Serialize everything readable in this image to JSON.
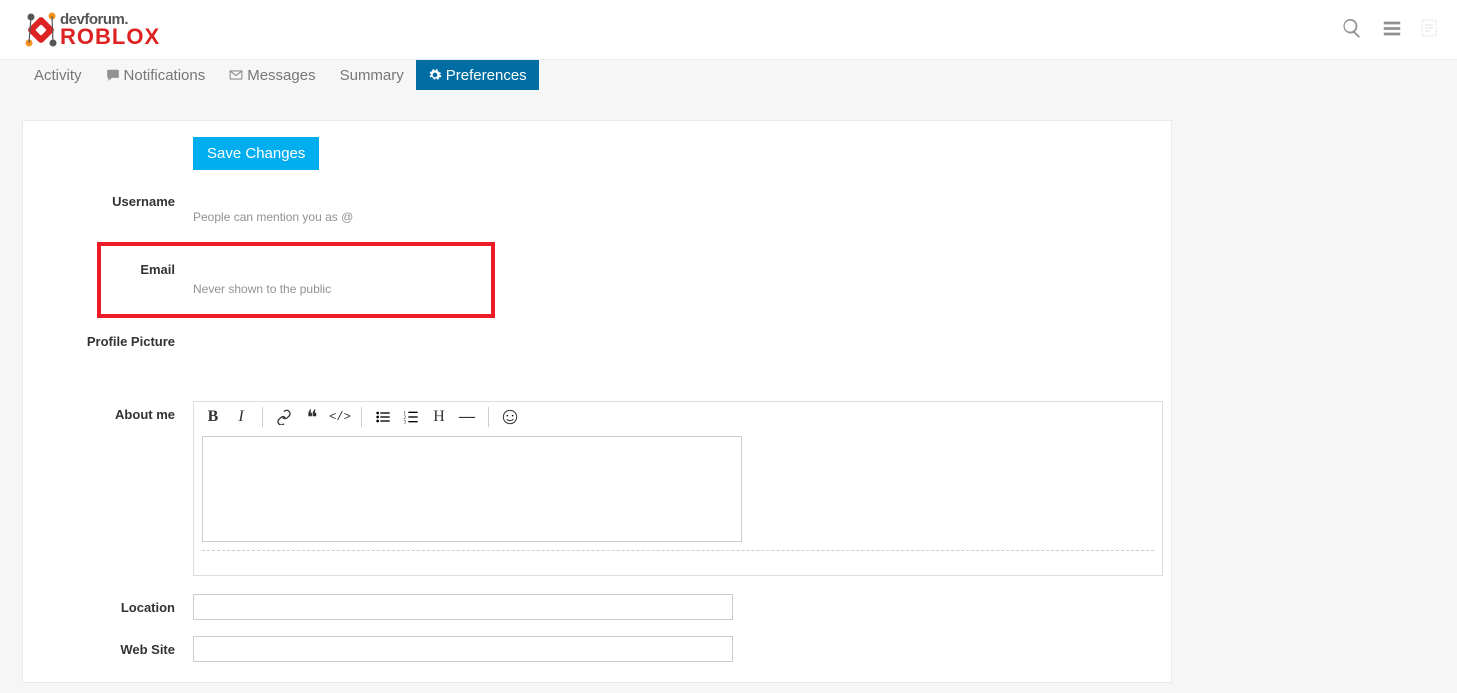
{
  "logo": {
    "top": "devforum",
    "bottom": "ROBLOX"
  },
  "tabs": {
    "activity": "Activity",
    "notifications": "Notifications",
    "messages": "Messages",
    "summary": "Summary",
    "preferences": "Preferences"
  },
  "buttons": {
    "save": "Save Changes"
  },
  "labels": {
    "username": "Username",
    "email": "Email",
    "profile_picture": "Profile Picture",
    "about_me": "About me",
    "location": "Location",
    "web_site": "Web Site"
  },
  "hints": {
    "mention": "People can mention you as @",
    "email_privacy": "Never shown to the public"
  },
  "fields": {
    "username": "",
    "mention_handle": "",
    "email": "",
    "about_me": "",
    "location": "",
    "web_site": ""
  },
  "toolbar": {
    "bold": "B",
    "italic": "I",
    "heading": "H",
    "hr": "—"
  }
}
